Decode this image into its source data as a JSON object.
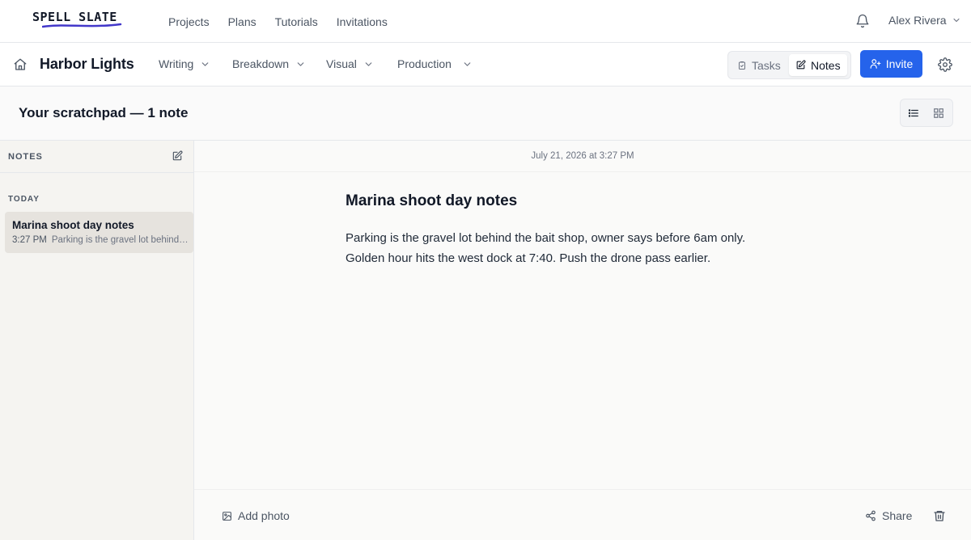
{
  "brand": {
    "logo_text": "SPELL SLATE",
    "accent_color": "#2563eb",
    "underline_color": "#4338ca"
  },
  "topnav": {
    "items": [
      {
        "label": "Projects"
      },
      {
        "label": "Plans"
      },
      {
        "label": "Tutorials"
      },
      {
        "label": "Invitations"
      }
    ],
    "notification_icon": "bell-icon",
    "user_name": "Alex Rivera"
  },
  "project": {
    "title": "Harbor Lights",
    "menus": [
      {
        "label": "Writing"
      },
      {
        "label": "Breakdown"
      },
      {
        "label": "Visual"
      },
      {
        "label": "Production"
      }
    ],
    "segment": {
      "tasks_label": "Tasks",
      "notes_label": "Notes",
      "active": "notes"
    },
    "invite_label": "Invite"
  },
  "scratchpad": {
    "title": "Your scratchpad — 1 note",
    "view_mode": "list"
  },
  "sidebar": {
    "header": "NOTES",
    "groups": [
      {
        "label": "TODAY",
        "notes": [
          {
            "title": "Marina shoot day notes",
            "time": "3:27 PM",
            "preview": "Parking is the gravel lot behind the bait shop, owner says before 6am only.",
            "selected": true
          }
        ]
      }
    ]
  },
  "editor": {
    "timestamp": "July 21, 2026 at 3:27 PM",
    "title": "Marina shoot day notes",
    "body_lines": [
      "Parking is the gravel lot behind the bait shop, owner says before 6am only.",
      "Golden hour hits the west dock at 7:40. Push the drone pass earlier."
    ],
    "add_photo_label": "Add photo",
    "share_label": "Share"
  }
}
